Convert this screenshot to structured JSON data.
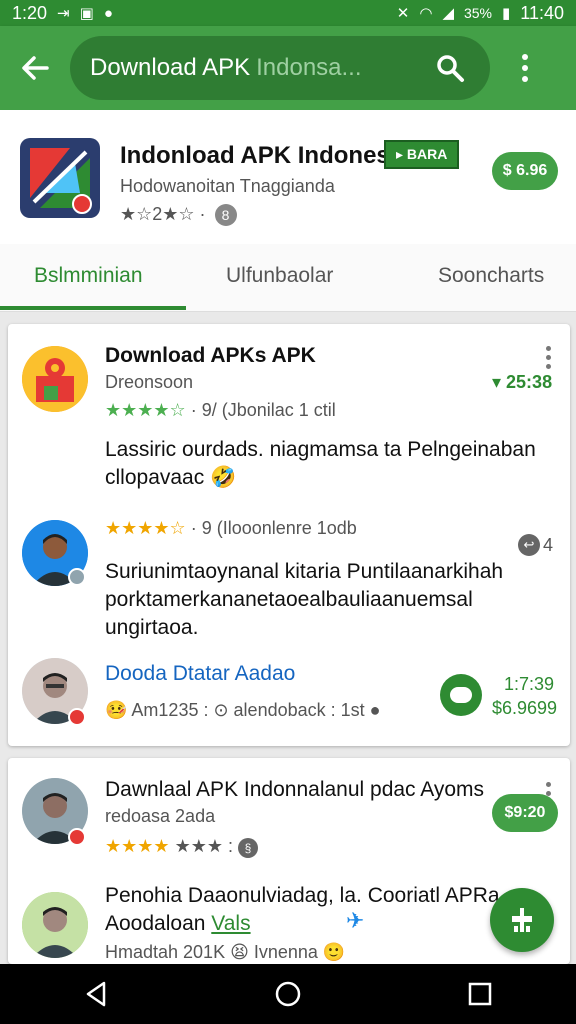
{
  "status_bar": {
    "time_left": "1:20",
    "time_right": "11:40",
    "battery": "35%"
  },
  "toolbar": {
    "search_query": "Download APK",
    "search_placeholder": "Indonsa...",
    "icons": {
      "back": "arrow-left-icon",
      "search": "search-icon",
      "more": "more-vert-icon"
    }
  },
  "app": {
    "title": "Indonload APK Indonesia",
    "badge": "▸ BARA",
    "subtitle": "Hodowanoitan Tnaggianda",
    "rating_text": "★☆2★☆ ·",
    "price": "$ 6.96"
  },
  "tabs": {
    "items": [
      "Bslmminian",
      "Ulfunbaolar",
      "Sooncharts"
    ],
    "active_index": 0
  },
  "card1": {
    "item1": {
      "title": "Download APKs APK",
      "subtitle": "Dreonsoon",
      "price": "▾ 25:38",
      "rating": "· 9/ (Jbonilac 1 ctil",
      "body": "Lassiric ourdads. niagmamsa ta Pelngeinaban cllopavaac 🤣"
    },
    "item2": {
      "rating": "· 9 (Ilooonlenre 1odb",
      "reply_count": "4",
      "body": "Suriunimtaoynanal kitaria Puntilaanarkihah porktamerkananetaoealbauliaanuemsal ungirtaoa."
    },
    "item3": {
      "link": "Dooda Dtatar Aadao",
      "meta": "🤒 Am1235 : ⊙ alendoback : 1st ●",
      "time": "1:7:39",
      "amount": "$6.9699"
    }
  },
  "card2": {
    "item1": {
      "title": "Dawnlaal APK Indonnalanul pdac Ayoms",
      "subtitle": "redoasa 2ada",
      "rating": "★★★ :",
      "price": "$9:20"
    },
    "item2": {
      "title": "Penohia Daaonulviadag, la. Cooriatl APRa",
      "title2": "Aoodaloan",
      "link_word": "Vals",
      "meta": "Hmadtah 201K 😫 Ivnenna 🙂"
    }
  }
}
